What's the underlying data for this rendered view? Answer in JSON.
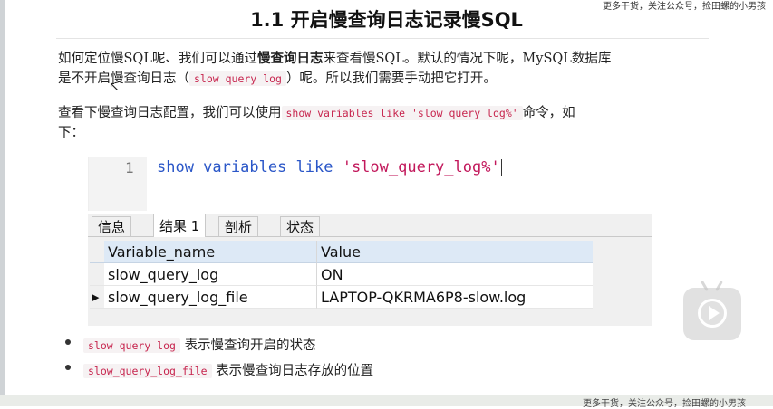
{
  "title": "1.1 开启慢查询日志记录慢SQL",
  "watermark_top": "更多干货，关注公众号，捡田螺的小男孩",
  "watermark_bottom": "更多干货，关注公众号，捡田螺的小男孩",
  "para1": {
    "part1": "如何定位慢SQL呢、我们可以通过",
    "bold": "慢查询日志",
    "part2": "来查看慢SQL。默认的情况下呢，MySQL数据库",
    "line2_a": "是不开启慢查询日志（",
    "code": "slow query log",
    "line2_b": "）呢。所以我们需要手动把它打开。"
  },
  "para2": {
    "part1": "查看下慢查询日志配置，我们可以使用",
    "code": "show variables like 'slow_query_log%'",
    "part2": "命令，如",
    "line2": "下："
  },
  "editor": {
    "line_number": "1",
    "sql_keyword": "show variables like ",
    "sql_string": "'slow_query_log%'"
  },
  "tabs": [
    {
      "label": "信息"
    },
    {
      "label": "结果 1"
    },
    {
      "label": "剖析"
    },
    {
      "label": "状态"
    }
  ],
  "grid": {
    "headers": [
      "Variable_name",
      "Value"
    ],
    "rows": [
      {
        "marker": "",
        "name": "slow_query_log",
        "value": "ON"
      },
      {
        "marker": "▶",
        "name": "slow_query_log_file",
        "value": "LAPTOP-QKRMA6P8-slow.log"
      }
    ]
  },
  "bullets": [
    {
      "code": "slow query log",
      "text": "表示慢查询开启的状态"
    },
    {
      "code": "slow_query_log_file",
      "text": "表示慢查询日志存放的位置"
    }
  ],
  "icons": {
    "cursor": "mouse-pointer-icon",
    "play": "bilibili-play-icon"
  }
}
